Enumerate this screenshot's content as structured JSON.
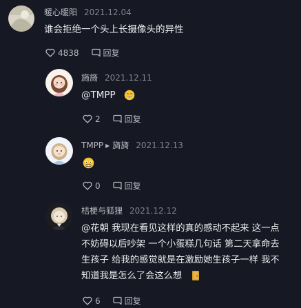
{
  "comments": [
    {
      "author": "暖心暖阳",
      "date": "2021.12.04",
      "text": "谁会拒绝一个头上长摄像头的异性",
      "likes": "4838",
      "reply_label": "回复"
    },
    {
      "author": "旖旖",
      "date": "2021.12.11",
      "text": "@TMPP",
      "likes": "2",
      "reply_label": "回复"
    },
    {
      "author": "TMPP",
      "reply_to": "旖旖",
      "date": "2021.12.13",
      "likes": "0",
      "reply_label": "回复"
    },
    {
      "author": "桔梗与狐狸",
      "date": "2021.12.12",
      "text_lines": [
        "@花朝  我现在看见这样的真的感动不起来 这一点",
        "不妨碍以后吵架 一个小蛋糕几句话 第二天拿命去",
        "生孩子 给我的感觉就是在激励她生孩子一样 我不",
        "知道我是怎么了会这么想"
      ],
      "likes": "6",
      "reply_label": "回复"
    }
  ],
  "icons": {
    "like": "heart-outline-icon",
    "reply": "comment-bubble-icon",
    "arrow": "triangle-right-icon"
  },
  "colors": {
    "background": "#161823",
    "text": "#ececf0",
    "muted": "#b8b9c0",
    "date": "#82838b"
  }
}
